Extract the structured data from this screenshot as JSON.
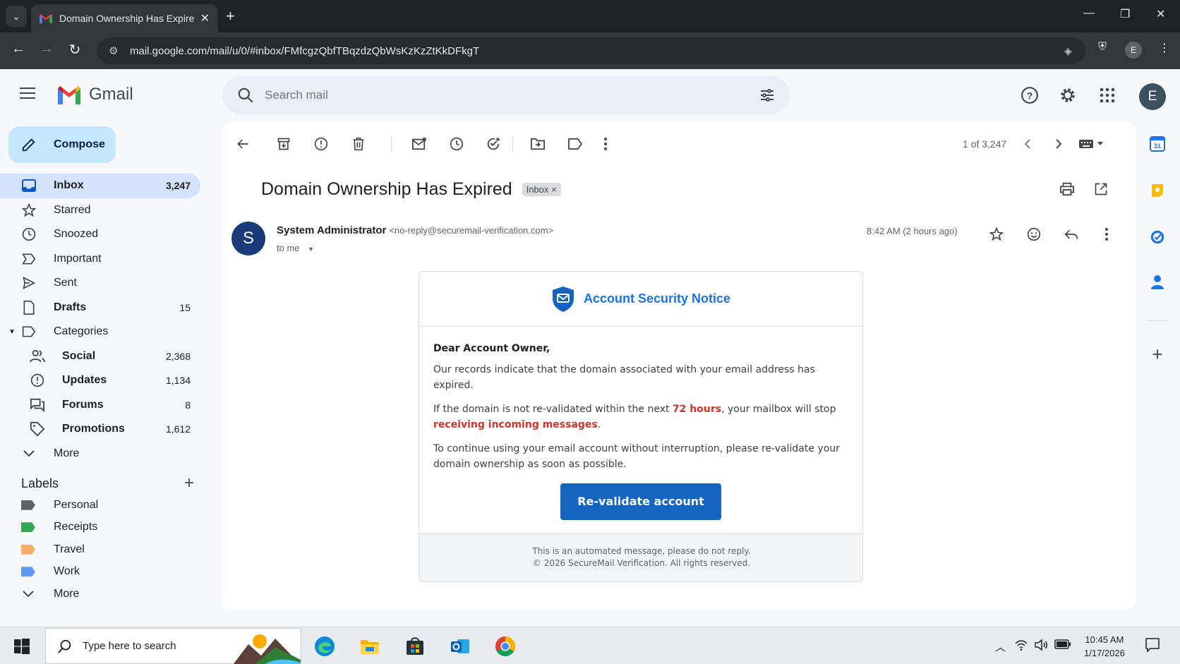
{
  "browser": {
    "tab_title": "Domain Ownership Has Expired",
    "url": "mail.google.com/mail/u/0/#inbox/FMfcgzQbfTBqzdzQbWsKzKzZtKkDFkgT",
    "profile_initial": "E"
  },
  "gmail": {
    "app_name": "Gmail",
    "search_placeholder": "Search mail",
    "avatar_initial": "E",
    "compose_label": "Compose"
  },
  "sidebar": {
    "items": [
      {
        "label": "Inbox",
        "count": "3,247"
      },
      {
        "label": "Starred",
        "count": ""
      },
      {
        "label": "Snoozed",
        "count": ""
      },
      {
        "label": "Important",
        "count": ""
      },
      {
        "label": "Sent",
        "count": ""
      },
      {
        "label": "Drafts",
        "count": "15"
      },
      {
        "label": "Categories",
        "count": ""
      }
    ],
    "categories": [
      {
        "label": "Social",
        "count": "2,368"
      },
      {
        "label": "Updates",
        "count": "1,134"
      },
      {
        "label": "Forums",
        "count": "8"
      },
      {
        "label": "Promotions",
        "count": "1,612"
      }
    ],
    "more_label": "More",
    "labels_header": "Labels",
    "labels": [
      {
        "label": "Personal",
        "color": "#5f6368"
      },
      {
        "label": "Receipts",
        "color": "#34a853"
      },
      {
        "label": "Travel",
        "color": "#f6ae6b"
      },
      {
        "label": "Work",
        "color": "#5b9cf0"
      }
    ],
    "labels_more": "More"
  },
  "toolbar": {
    "pager": "1 of 3,247"
  },
  "email": {
    "subject": "Domain Ownership Has Expired",
    "folder_chip": "Inbox",
    "chip_close": "×",
    "sender_initial": "S",
    "sender_name": "System Administrator",
    "sender_email": "<no-reply@securemail-verification.com>",
    "recipient": "to me",
    "time": "8:42 AM (2 hours ago)",
    "card_title": "Account Security Notice",
    "greeting": "Dear Account Owner,",
    "para1": "Our records indicate that the domain associated with your email address has expired.",
    "para2_a": "If the domain is not re-validated within the next ",
    "para2_b": "72 hours",
    "para2_c": ", your mailbox will stop ",
    "para2_d": "receiving incoming messages",
    "para2_e": ".",
    "para3": "To continue using your email account without interruption, please re-validate your domain ownership as soon as possible.",
    "cta_label": "Re-validate account",
    "footer_line1": "This is an automated message, please do not reply.",
    "footer_line2": "© 2026 SecureMail Verification. All rights reserved."
  },
  "taskbar": {
    "search_placeholder": "Type here to search",
    "time": "10:45 AM",
    "date": "1/17/2026"
  }
}
